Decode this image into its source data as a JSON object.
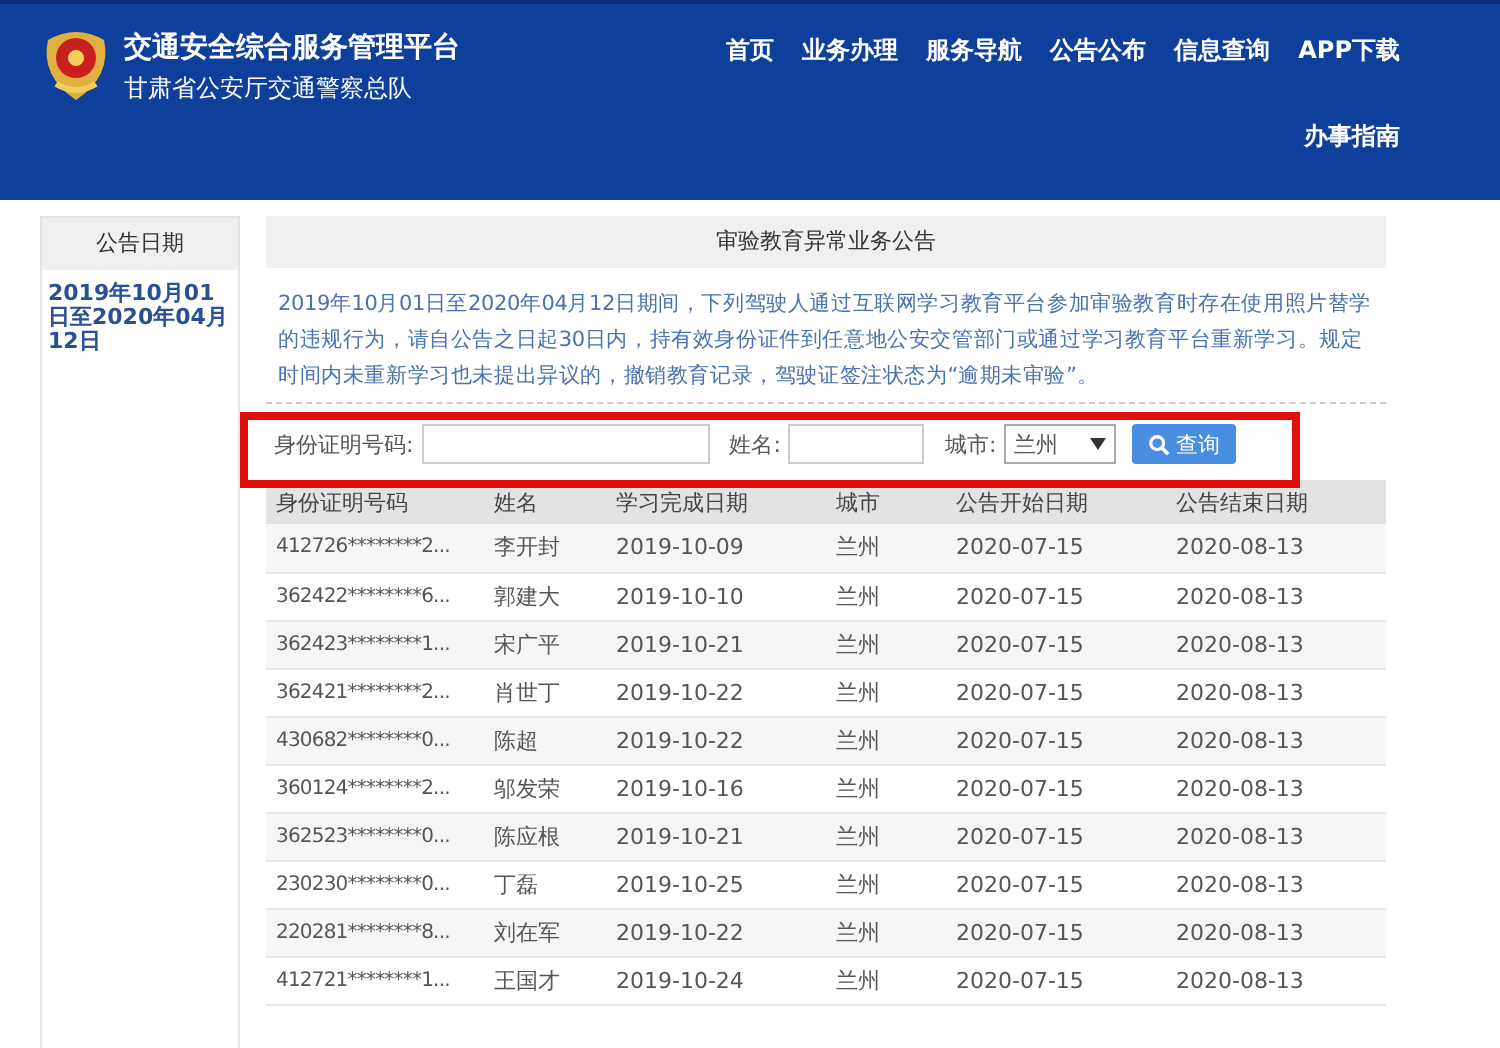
{
  "header": {
    "title": "交通安全综合服务管理平台",
    "subtitle": "甘肃省公安厅交通警察总队",
    "nav": [
      "首页",
      "业务办理",
      "服务导航",
      "公告公布",
      "信息查询",
      "APP下载",
      "办事指南"
    ]
  },
  "sidebar": {
    "heading": "公告日期",
    "date": "2019年10月01日至2020年04月12日"
  },
  "notice": {
    "title": "审验教育异常业务公告",
    "text": "2019年10月01日至2020年04月12日期间，下列驾驶人通过互联网学习教育平台参加审验教育时存在使用照片替学的违规行为，请自公告之日起30日内，持有效身份证件到任意地公安交管部门或通过学习教育平台重新学习。规定时间内未重新学习也未提出异议的，撤销教育记录，驾驶证签注状态为“逾期未审验”。"
  },
  "search": {
    "highlighted": true,
    "id_label": "身份证明号码:",
    "name_label": "姓名:",
    "city_label": "城市:",
    "city_value": "兰州",
    "button": "查询"
  },
  "table": {
    "columns": [
      "身份证明号码",
      "姓名",
      "学习完成日期",
      "城市",
      "公告开始日期",
      "公告结束日期"
    ],
    "rows": [
      [
        "412726********2...",
        "李开封",
        "2019-10-09",
        "兰州",
        "2020-07-15",
        "2020-08-13"
      ],
      [
        "362422********6...",
        "郭建大",
        "2019-10-10",
        "兰州",
        "2020-07-15",
        "2020-08-13"
      ],
      [
        "362423********1...",
        "宋广平",
        "2019-10-21",
        "兰州",
        "2020-07-15",
        "2020-08-13"
      ],
      [
        "362421********2...",
        "肖世丁",
        "2019-10-22",
        "兰州",
        "2020-07-15",
        "2020-08-13"
      ],
      [
        "430682********0...",
        "陈超",
        "2019-10-22",
        "兰州",
        "2020-07-15",
        "2020-08-13"
      ],
      [
        "360124********2...",
        "邬发荣",
        "2019-10-16",
        "兰州",
        "2020-07-15",
        "2020-08-13"
      ],
      [
        "362523********0...",
        "陈应根",
        "2019-10-21",
        "兰州",
        "2020-07-15",
        "2020-08-13"
      ],
      [
        "230230********0...",
        "丁磊",
        "2019-10-25",
        "兰州",
        "2020-07-15",
        "2020-08-13"
      ],
      [
        "220281********8...",
        "刘在军",
        "2019-10-22",
        "兰州",
        "2020-07-15",
        "2020-08-13"
      ],
      [
        "412721********1...",
        "王国才",
        "2019-10-24",
        "兰州",
        "2020-07-15",
        "2020-08-13"
      ]
    ]
  }
}
